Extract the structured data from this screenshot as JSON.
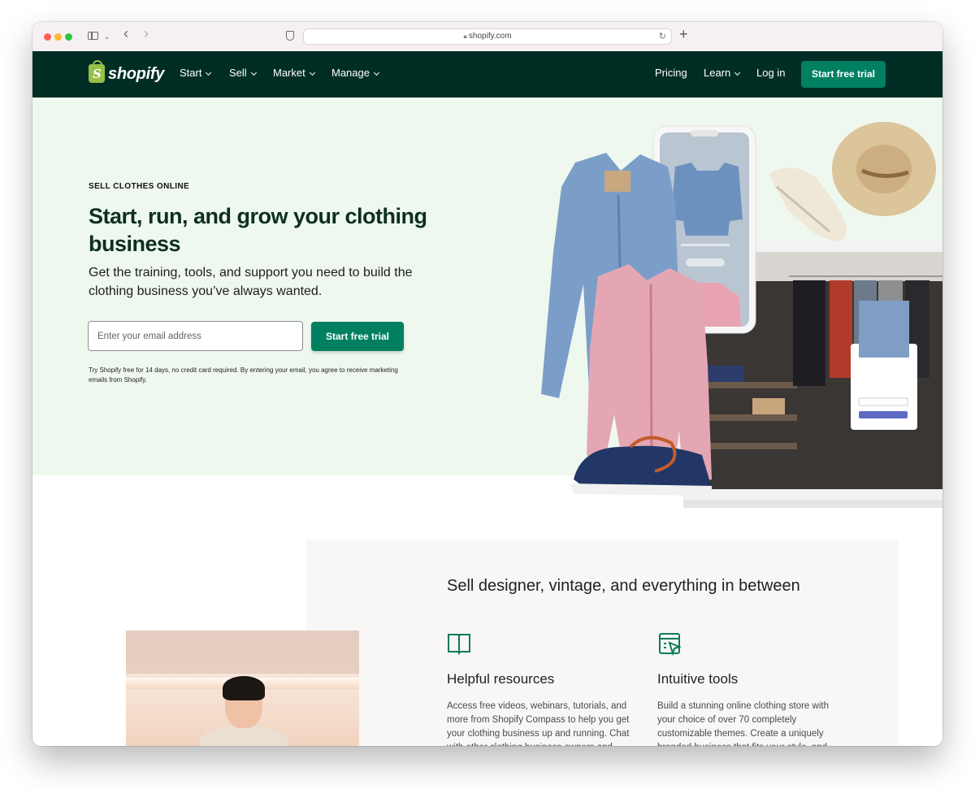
{
  "browser": {
    "url": "shopify.com",
    "icons": [
      "sidebar-icon",
      "chevron-down-icon",
      "back-icon",
      "forward-icon",
      "shield-icon",
      "lock-icon",
      "reload-icon",
      "new-tab-icon"
    ]
  },
  "nav": {
    "logo_text": "shopify",
    "left_items": [
      "Start",
      "Sell",
      "Market",
      "Manage"
    ],
    "pricing": "Pricing",
    "learn": "Learn",
    "login": "Log in",
    "cta": "Start free trial"
  },
  "hero": {
    "eyebrow": "SELL CLOTHES ONLINE",
    "title": "Start, run, and grow your clothing business",
    "subtitle": "Get the training, tools, and support you need to build the clothing business you’ve always wanted.",
    "email_placeholder": "Enter your email address",
    "cta": "Start free trial",
    "legal": "Try Shopify free for 14 days, no credit card required. By entering your email, you agree to receive marketing emails from Shopify."
  },
  "features_section": {
    "title": "Sell designer, vintage, and everything in between",
    "features": [
      {
        "icon": "book-icon",
        "title": "Helpful resources",
        "text": "Access free videos, webinars, tutorials, and more from Shopify Compass to help you get your clothing business up and running. Chat with other clothing business owners and"
      },
      {
        "icon": "theme-editor-icon",
        "title": "Intuitive tools",
        "text": "Build a stunning online clothing store with your choice of over 70 completely customizable themes. Create a uniquely branded business that fits your style, and"
      }
    ]
  },
  "colors": {
    "nav_bg": "#002e25",
    "brand_green": "#008060",
    "hero_bg": "#eff8ef",
    "logo_green": "#95bf47"
  }
}
